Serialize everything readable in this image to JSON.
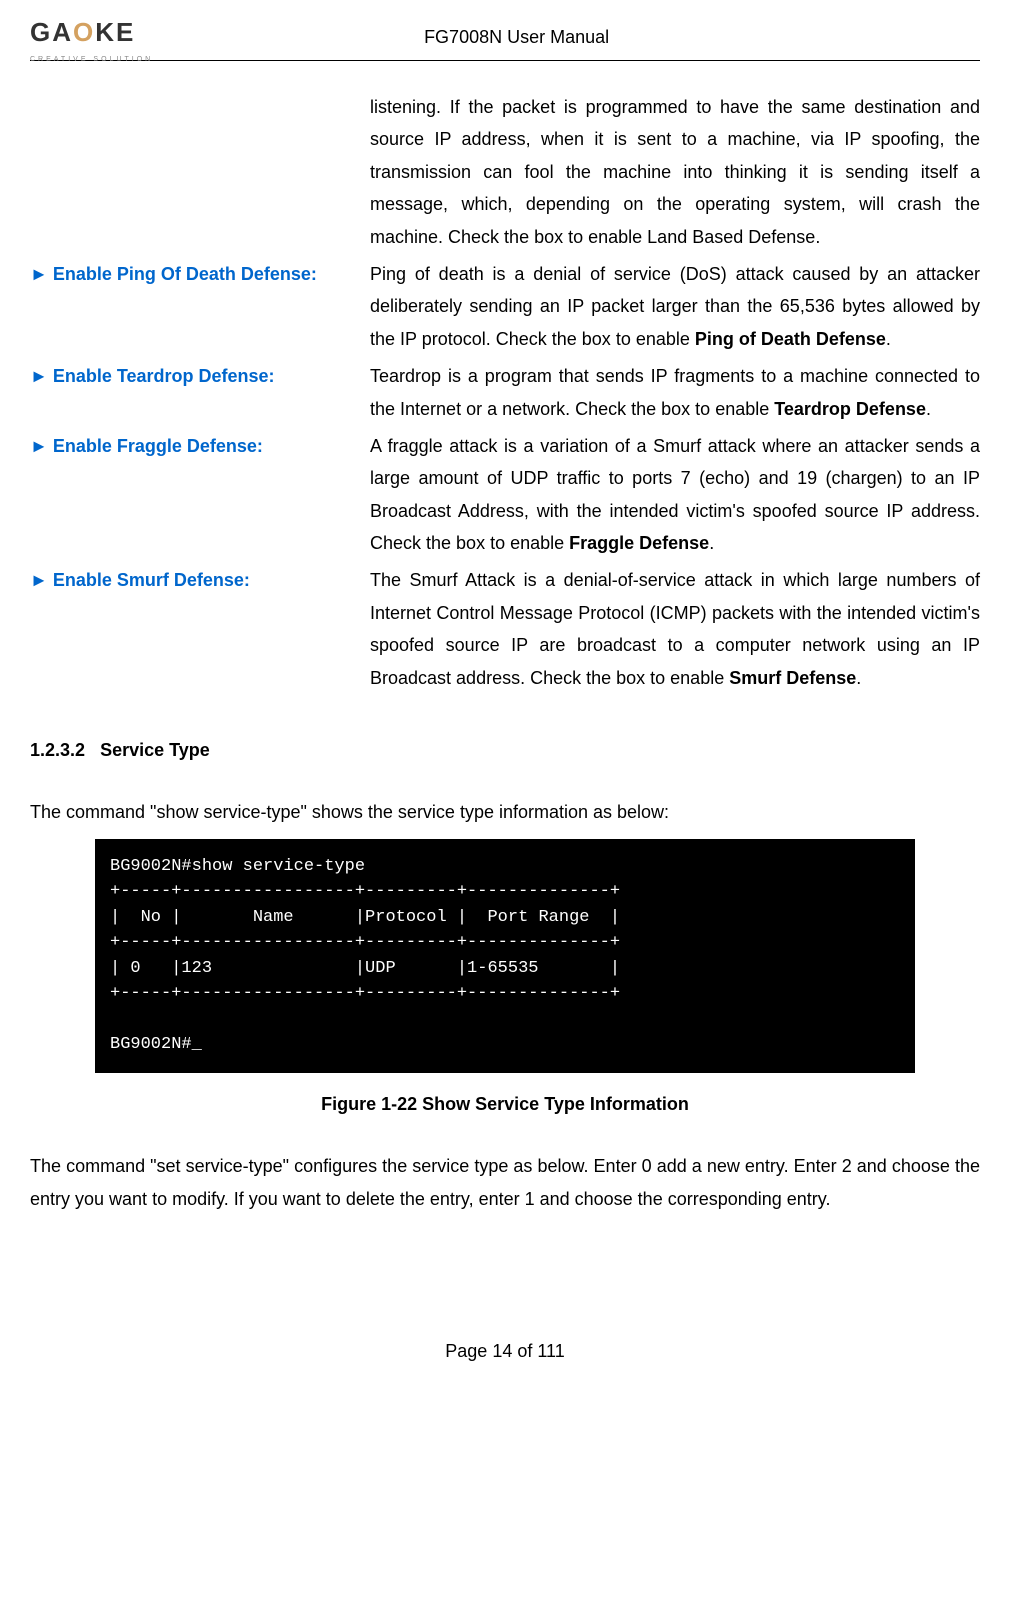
{
  "header": {
    "logo_main": "GAOKE",
    "logo_sub": "CREATIVE SOLUTION",
    "title": "FG7008N User Manual"
  },
  "continuation_text": "listening. If the packet is programmed to have the same destination and source IP address, when it is sent to a machine, via IP spoofing, the transmission can fool the machine into thinking it is sending itself a message, which, depending on the operating system, will crash the machine. Check the box to enable ",
  "continuation_bold": "Land Based Defense",
  "definitions": [
    {
      "label": "► Enable Ping Of Death Defense:",
      "text": "Ping of death is a denial of service (DoS) attack caused by an attacker deliberately sending an IP packet larger than the 65,536 bytes allowed by the IP protocol. Check the box to enable ",
      "bold": "Ping of Death Defense"
    },
    {
      "label": "► Enable Teardrop Defense:",
      "text": "Teardrop is a program that sends IP fragments to a machine connected to the Internet or a network. Check the box to enable ",
      "bold": "Teardrop Defense"
    },
    {
      "label": "► Enable Fraggle Defense:",
      "text": "A fraggle attack is a variation of a Smurf attack where an attacker sends a large amount of UDP traffic to ports 7 (echo) and 19 (chargen) to an IP Broadcast Address, with the intended victim's spoofed source IP address. Check the box to enable ",
      "bold": "Fraggle Defense"
    },
    {
      "label": "► Enable Smurf Defense:",
      "text": "The Smurf Attack is a denial-of-service attack in which large numbers of Internet Control Message Protocol (ICMP) packets with the intended victim's spoofed source IP are broadcast to a computer network using an IP Broadcast address. Check the box to enable ",
      "bold": "Smurf Defense"
    }
  ],
  "section": {
    "number": "1.2.3.2",
    "title": "Service Type"
  },
  "para1": "The command \"show service-type\" shows the service type information as below:",
  "terminal": "BG9002N#show service-type\n+-----+-----------------+---------+--------------+\n|  No |       Name      |Protocol |  Port Range  |\n+-----+-----------------+---------+--------------+\n| 0   |123              |UDP      |1-65535       |\n+-----+-----------------+---------+--------------+\n\nBG9002N#_",
  "figure_caption": "Figure 1-22   Show Service Type Information",
  "para2": "The command \"set service-type\" configures the service type as below. Enter 0 add a new entry. Enter 2 and choose the entry you want to modify. If you want to delete the entry, enter 1 and choose the corresponding entry.",
  "footer": "Page 14 of 111"
}
